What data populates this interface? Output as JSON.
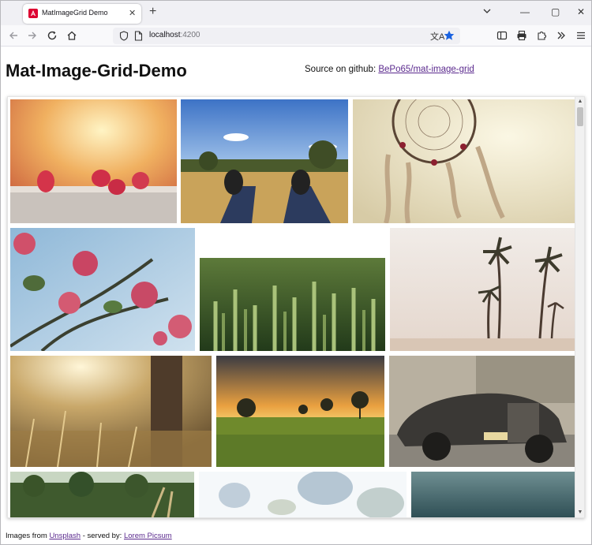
{
  "browser": {
    "tab_title": "MatImageGrid Demo",
    "url_host": "localhost",
    "url_port": ":4200"
  },
  "page": {
    "title": "Mat-Image-Grid-Demo",
    "source_label": "Source on github:",
    "source_link": "BePo65/mat-image-grid"
  },
  "grid": {
    "images": [
      {
        "name": "raspberries"
      },
      {
        "name": "sneakers-on-field"
      },
      {
        "name": "dreamcatcher"
      },
      {
        "name": "pink-flowers-sky"
      },
      {
        "name": "wheat-field"
      },
      {
        "name": "palm-trees"
      },
      {
        "name": "tree-trunk-sunlight"
      },
      {
        "name": "sunset-trees"
      },
      {
        "name": "vintage-car"
      },
      {
        "name": "treeline-grass"
      },
      {
        "name": "blurred-foliage"
      },
      {
        "name": "teal-sky"
      }
    ]
  },
  "footer": {
    "images_from": "Images from",
    "unsplash": "Unsplash",
    "separator": "-  served by:",
    "picsum": "Lorem Picsum"
  },
  "colors": {
    "link": "#5b2a8e",
    "star": "#1a62e0"
  }
}
